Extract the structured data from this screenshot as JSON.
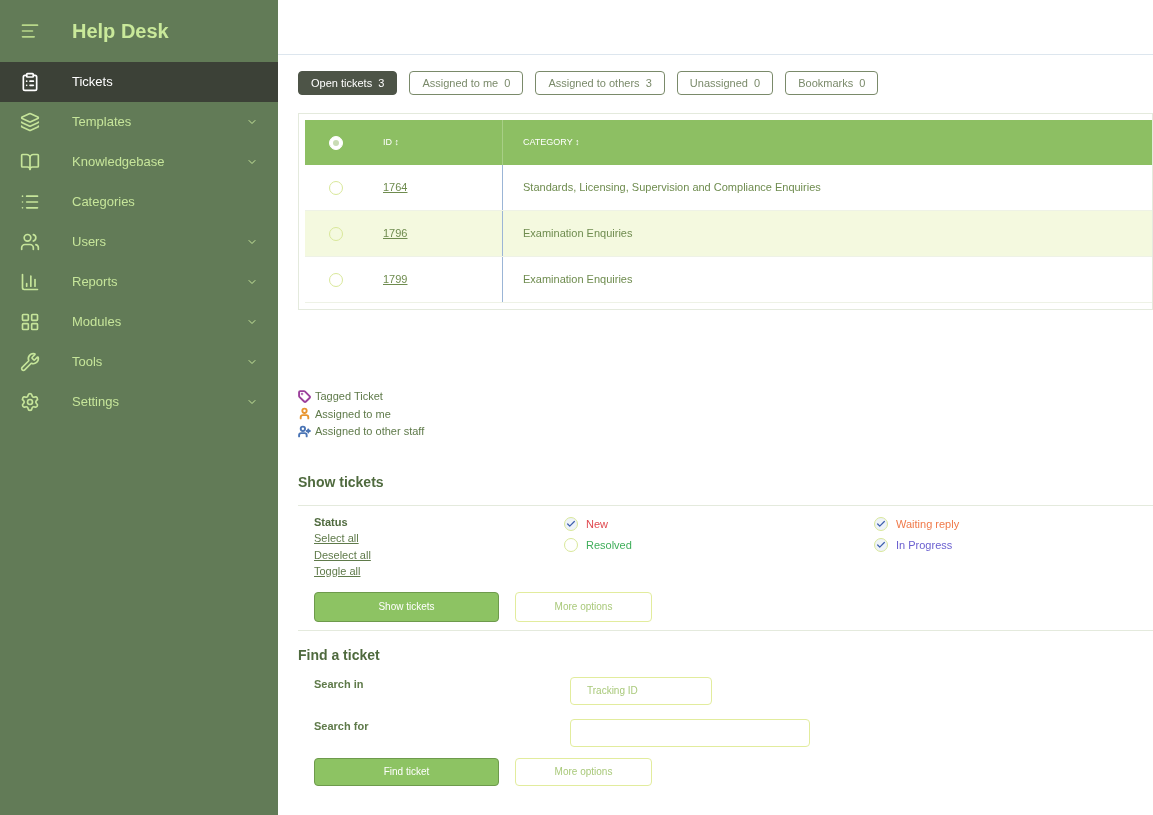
{
  "sidebar": {
    "title": "Help Desk",
    "items": [
      {
        "label": "Tickets",
        "selected": true,
        "expandable": false
      },
      {
        "label": "Templates",
        "selected": false,
        "expandable": true
      },
      {
        "label": "Knowledgebase",
        "selected": false,
        "expandable": true
      },
      {
        "label": "Categories",
        "selected": false,
        "expandable": false
      },
      {
        "label": "Users",
        "selected": false,
        "expandable": true
      },
      {
        "label": "Reports",
        "selected": false,
        "expandable": true
      },
      {
        "label": "Modules",
        "selected": false,
        "expandable": true
      },
      {
        "label": "Tools",
        "selected": false,
        "expandable": true
      },
      {
        "label": "Settings",
        "selected": false,
        "expandable": true
      }
    ]
  },
  "tabs": [
    {
      "label": "Open tickets",
      "count": "3",
      "selected": true
    },
    {
      "label": "Assigned to me",
      "count": "0",
      "selected": false
    },
    {
      "label": "Assigned to others",
      "count": "3",
      "selected": false
    },
    {
      "label": "Unassigned",
      "count": "0",
      "selected": false
    },
    {
      "label": "Bookmarks",
      "count": "0",
      "selected": false
    }
  ],
  "table": {
    "columns": [
      "ID ↕",
      "CATEGORY ↕"
    ],
    "select_all_checked": true,
    "rows": [
      {
        "id": "1764",
        "category": "Standards, Licensing, Supervision and Compliance Enquiries",
        "checked": false,
        "highlighted": false
      },
      {
        "id": "1796",
        "category": "Examination Enquiries",
        "checked": false,
        "highlighted": true
      },
      {
        "id": "1799",
        "category": "Examination Enquiries",
        "checked": false,
        "highlighted": false
      }
    ]
  },
  "legend": [
    {
      "kind": "tag",
      "label": "Tagged Ticket",
      "color": "#9b3f9b"
    },
    {
      "kind": "person",
      "label": "Assigned to me",
      "color": "#e8952f"
    },
    {
      "kind": "people",
      "label": "Assigned to other staff",
      "color": "#4a74b5"
    }
  ],
  "show_tickets": {
    "title": "Show tickets",
    "status_label": "Status",
    "links": [
      "Select all",
      "Deselect all",
      "Toggle all"
    ],
    "statuses": [
      {
        "label": "New",
        "checked": true,
        "color": "#e0484f"
      },
      {
        "label": "Resolved",
        "checked": false,
        "color": "#3fae5a"
      },
      {
        "label": "Waiting reply",
        "checked": true,
        "color": "#f07a4a"
      },
      {
        "label": "In Progress",
        "checked": true,
        "color": "#6a5fd0"
      }
    ],
    "submit": "Show tickets",
    "more": "More options"
  },
  "find_ticket": {
    "title": "Find a ticket",
    "search_in_label": "Search in",
    "search_in_value": "Tracking ID",
    "search_for_label": "Search for",
    "submit": "Find ticket",
    "more": "More options"
  }
}
